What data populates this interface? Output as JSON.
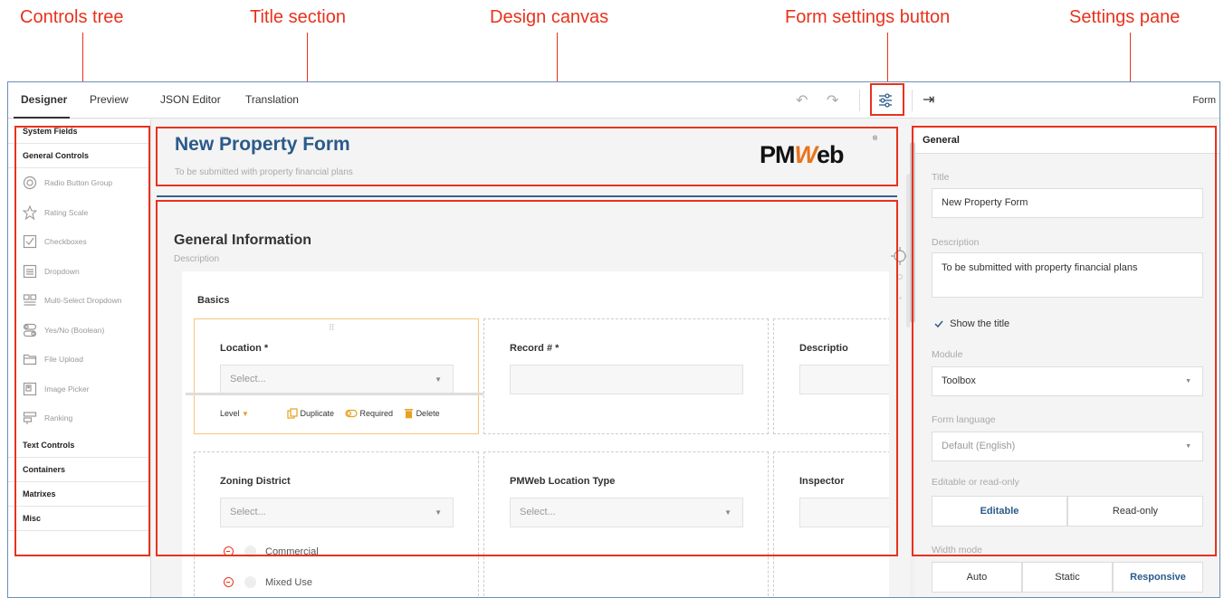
{
  "annotations": {
    "controls_tree": "Controls tree",
    "title_section": "Title section",
    "design_canvas": "Design canvas",
    "form_settings_button": "Form settings button",
    "settings_pane": "Settings pane"
  },
  "topbar": {
    "tabs": [
      "Designer",
      "Preview",
      "JSON Editor",
      "Translation"
    ],
    "active_tab": "Designer",
    "pane_title": "Form"
  },
  "toolbox": {
    "system_fields": "System Fields",
    "general_controls": "General Controls",
    "items": [
      {
        "label": "Radio Button Group",
        "icon": "radio-icon"
      },
      {
        "label": "Rating Scale",
        "icon": "star-icon"
      },
      {
        "label": "Checkboxes",
        "icon": "checkbox-icon"
      },
      {
        "label": "Dropdown",
        "icon": "dropdown-icon"
      },
      {
        "label": "Multi-Select Dropdown",
        "icon": "multi-select-icon"
      },
      {
        "label": "Yes/No (Boolean)",
        "icon": "toggle-icon"
      },
      {
        "label": "File Upload",
        "icon": "folder-icon"
      },
      {
        "label": "Image Picker",
        "icon": "image-icon"
      },
      {
        "label": "Ranking",
        "icon": "ranking-icon"
      }
    ],
    "text_controls": "Text Controls",
    "containers": "Containers",
    "matrixes": "Matrixes",
    "misc": "Misc"
  },
  "form": {
    "title": "New Property Form",
    "description": "To be submitted with property financial plans",
    "logo_text_a": "PM",
    "logo_text_w": "W",
    "logo_text_b": "eb",
    "logo_reg": "®"
  },
  "page": {
    "title": "General Information",
    "description": "Description",
    "panel_title": "Basics",
    "questions": [
      {
        "label": "Location *",
        "placeholder": "Select..."
      },
      {
        "label": "Record # *"
      },
      {
        "label": "Descriptio"
      },
      {
        "label": "Zoning District",
        "placeholder": "Select..."
      },
      {
        "label": "PMWeb Location Type",
        "placeholder": "Select..."
      },
      {
        "label": "Inspector"
      }
    ],
    "adorners": {
      "level": "Level",
      "duplicate": "Duplicate",
      "required": "Required",
      "delete": "Delete"
    },
    "choices": [
      "Commercial",
      "Mixed Use"
    ]
  },
  "settings": {
    "section": "General",
    "title_label": "Title",
    "title_value": "New Property Form",
    "description_label": "Description",
    "description_value": "To be submitted with property financial plans",
    "show_title": "Show the title",
    "module_label": "Module",
    "module_value": "Toolbox",
    "language_label": "Form language",
    "language_value": "Default (English)",
    "editable_label": "Editable or read-only",
    "editable_options": [
      "Editable",
      "Read-only"
    ],
    "width_label": "Width mode",
    "width_options": [
      "Auto",
      "Static",
      "Responsive"
    ]
  },
  "colors": {
    "annotation": "#e8321d",
    "accent": "#2b5a8a",
    "adorner": "#e8a020"
  }
}
